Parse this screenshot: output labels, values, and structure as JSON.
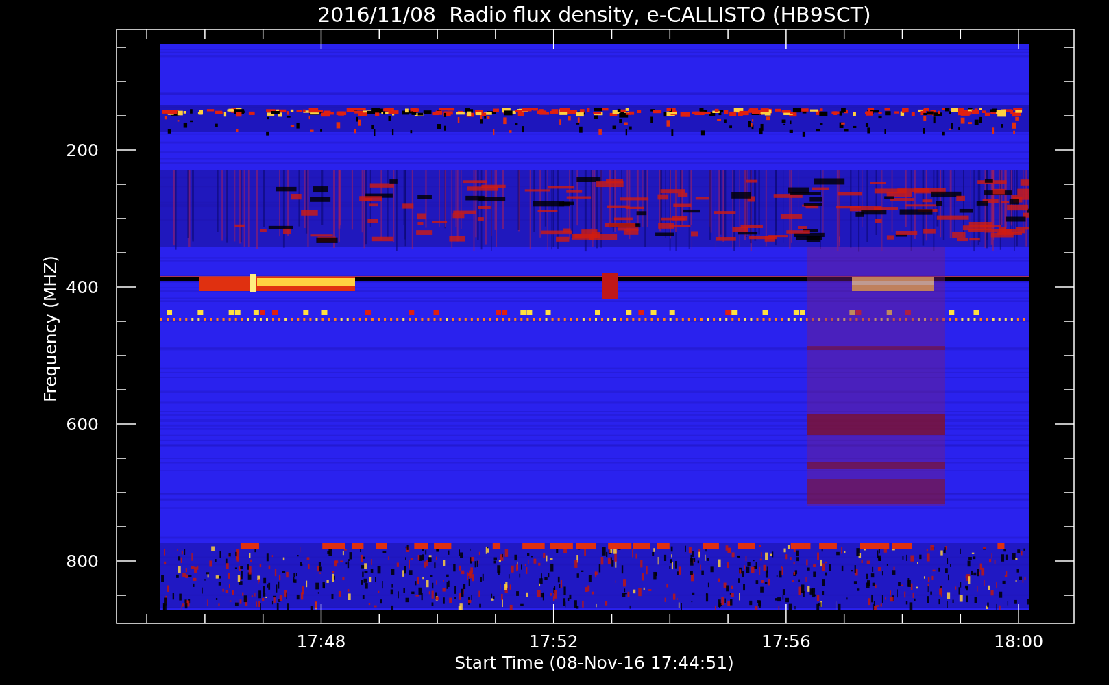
{
  "title": "2016/11/08  Radio flux density, e-CALLISTO (HB9SCT)",
  "y_axis": {
    "label": "Frequency (MHZ)",
    "ticks": [
      "200",
      "400",
      "600",
      "800"
    ]
  },
  "x_axis": {
    "label": "Start Time (08-Nov-16 17:44:51)",
    "ticks": [
      "17:48",
      "17:52",
      "17:56",
      "18:00"
    ]
  }
}
